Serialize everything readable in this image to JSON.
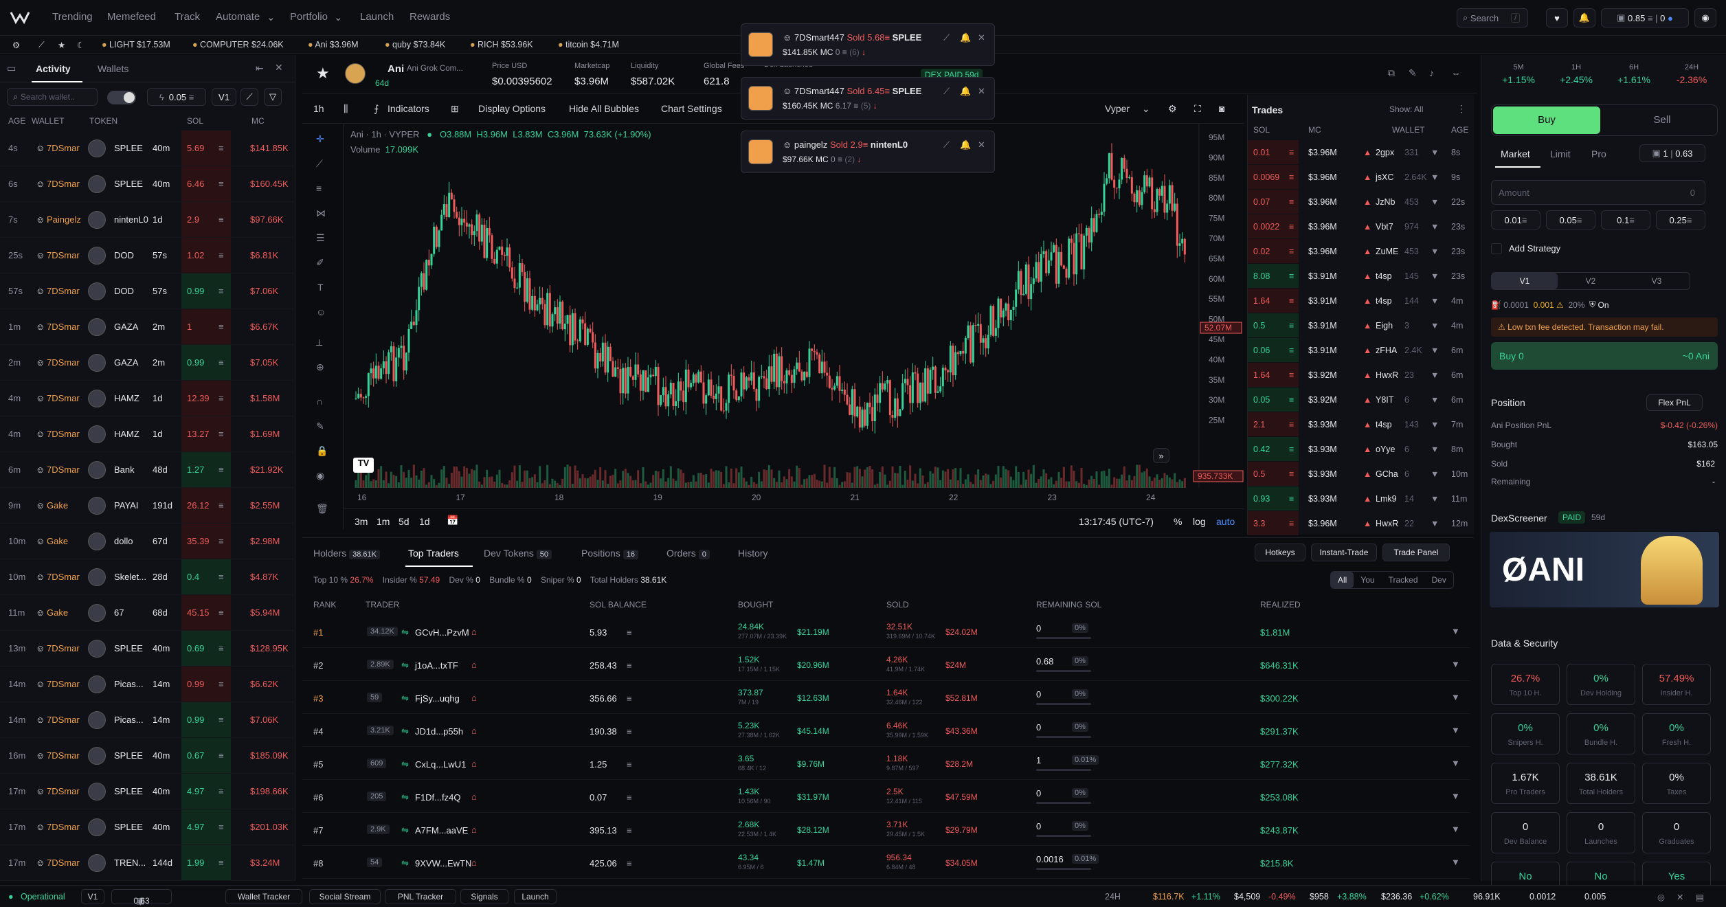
{
  "nav": {
    "items": [
      "Trending",
      "Memefeed",
      "Track",
      "Automate",
      "Portfolio",
      "Launch",
      "Rewards"
    ],
    "search_placeholder": "Search",
    "search_shortcut": "/",
    "wallet_balance": "0.85",
    "wallet_count": "0"
  },
  "ticker": [
    {
      "name": "LIGHT",
      "mc": "$17.53M"
    },
    {
      "name": "COMPUTER",
      "mc": "$24.06K"
    },
    {
      "name": "Ani",
      "mc": "$3.96M"
    },
    {
      "name": "quby",
      "mc": "$73.84K"
    },
    {
      "name": "RICH",
      "mc": "$53.96K"
    },
    {
      "name": "titcoin",
      "mc": "$4.71M"
    }
  ],
  "activity": {
    "tabs": [
      "Activity",
      "Wallets"
    ],
    "search_placeholder": "Search wallet..",
    "amount": "0.05",
    "version": "V1",
    "headers": [
      "AGE",
      "WALLET",
      "TOKEN",
      "SOL",
      "MC"
    ],
    "rows": [
      [
        "4s",
        "7DSmar",
        "SPLEE",
        "40m",
        "5.69",
        "$141.85K",
        "r"
      ],
      [
        "6s",
        "7DSmar",
        "SPLEE",
        "40m",
        "6.46",
        "$160.45K",
        "r"
      ],
      [
        "7s",
        "Paingelz",
        "nintenL0",
        "1d",
        "2.9",
        "$97.66K",
        "r"
      ],
      [
        "25s",
        "7DSmar",
        "DOD",
        "57s",
        "1.02",
        "$6.81K",
        "r"
      ],
      [
        "57s",
        "7DSmar",
        "DOD",
        "57s",
        "0.99",
        "$7.06K",
        "g"
      ],
      [
        "1m",
        "7DSmar",
        "GAZA",
        "2m",
        "1",
        "$6.67K",
        "r"
      ],
      [
        "2m",
        "7DSmar",
        "GAZA",
        "2m",
        "0.99",
        "$7.05K",
        "g"
      ],
      [
        "4m",
        "7DSmar",
        "HAMZ",
        "1d",
        "12.39",
        "$1.58M",
        "r"
      ],
      [
        "4m",
        "7DSmar",
        "HAMZ",
        "1d",
        "13.27",
        "$1.69M",
        "r"
      ],
      [
        "6m",
        "7DSmar",
        "Bank",
        "48d",
        "1.27",
        "$21.92K",
        "g"
      ],
      [
        "9m",
        "Gake",
        "PAYAI",
        "191d",
        "26.12",
        "$2.55M",
        "r"
      ],
      [
        "10m",
        "Gake",
        "dollo",
        "67d",
        "35.39",
        "$2.98M",
        "r"
      ],
      [
        "10m",
        "7DSmar",
        "Skelet...",
        "28d",
        "0.4",
        "$4.87K",
        "g"
      ],
      [
        "11m",
        "Gake",
        "67",
        "68d",
        "45.15",
        "$5.94M",
        "r"
      ],
      [
        "13m",
        "7DSmar",
        "SPLEE",
        "40m",
        "0.69",
        "$128.95K",
        "g"
      ],
      [
        "14m",
        "7DSmar",
        "Picas...",
        "14m",
        "0.99",
        "$6.62K",
        "r"
      ],
      [
        "14m",
        "7DSmar",
        "Picas...",
        "14m",
        "0.99",
        "$7.06K",
        "g"
      ],
      [
        "16m",
        "7DSmar",
        "SPLEE",
        "40m",
        "0.67",
        "$185.09K",
        "g"
      ],
      [
        "17m",
        "7DSmar",
        "SPLEE",
        "40m",
        "4.97",
        "$198.66K",
        "g"
      ],
      [
        "17m",
        "7DSmar",
        "SPLEE",
        "40m",
        "4.97",
        "$201.03K",
        "g"
      ],
      [
        "17m",
        "7DSmar",
        "TREN...",
        "144d",
        "1.99",
        "$3.24M",
        "g"
      ]
    ]
  },
  "token": {
    "symbol": "Ani",
    "name": "Ani Grok Com...",
    "age": "64d",
    "price_label": "Price USD",
    "price": "$0.00395602",
    "mc_label": "Marketcap",
    "mc": "$3.96M",
    "liq_label": "Liquidity",
    "liq": "$587.02K",
    "fees_label": "Global Fees",
    "fees": "621.8",
    "dex_label": "Dex Launched",
    "dex_paid": "DEX PAID 59d"
  },
  "chart_tools": {
    "interval": "1h",
    "indicators": "Indicators",
    "display": "Display Options",
    "hide": "Hide All Bubbles",
    "settings": "Chart Settings",
    "source": "Vyper"
  },
  "chart_legend": {
    "title": "Ani · 1h · VYPER",
    "o": "O3.88M",
    "h": "H3.96M",
    "l": "L3.83M",
    "c": "C3.96M",
    "chg": "73.63K (+1.90%)",
    "volume": "Volume",
    "vol_val": "17.099K",
    "last": "52.07M",
    "vol_last": "935.733K"
  },
  "chart_data": {
    "type": "candlestick",
    "y_ticks": [
      "95M",
      "90M",
      "85M",
      "80M",
      "75M",
      "70M",
      "65M",
      "60M",
      "55M",
      "50M",
      "45M",
      "40M",
      "35M",
      "30M",
      "25M"
    ],
    "x_ticks": [
      "16",
      "17",
      "18",
      "19",
      "20",
      "21",
      "22",
      "23",
      "24"
    ]
  },
  "chart_foot": {
    "ranges": [
      "3m",
      "1m",
      "5d",
      "1d"
    ],
    "time": "13:17:45 (UTC-7)",
    "pct": "%",
    "log": "log",
    "auto": "auto"
  },
  "toasts": [
    {
      "user": "7DSmart447",
      "action": "Sold",
      "amt": "5.68",
      "token": "SPLEE",
      "mc": "$141.85K MC",
      "extra": "0",
      "count": "(6)"
    },
    {
      "user": "7DSmart447",
      "action": "Sold",
      "amt": "6.45",
      "token": "SPLEE",
      "mc": "$160.45K MC",
      "extra": "6.17",
      "count": "(5)"
    },
    {
      "user": "paingelz",
      "action": "Sold",
      "amt": "2.9",
      "token": "nintenL0",
      "mc": "$97.66K MC",
      "extra": "0",
      "count": "(2)"
    }
  ],
  "trades": {
    "title": "Trades",
    "show": "Show: All",
    "headers": [
      "SOL",
      "MC",
      "WALLET",
      "AGE"
    ],
    "rows": [
      [
        "0.01",
        "$3.96M",
        "2gpx",
        "331",
        "8s",
        "r"
      ],
      [
        "0.0069",
        "$3.96M",
        "jsXC",
        "2.64K",
        "9s",
        "r"
      ],
      [
        "0.07",
        "$3.96M",
        "JzNb",
        "453",
        "22s",
        "r"
      ],
      [
        "0.0022",
        "$3.96M",
        "Vbt7",
        "974",
        "23s",
        "r"
      ],
      [
        "0.02",
        "$3.96M",
        "ZuME",
        "453",
        "23s",
        "r"
      ],
      [
        "8.08",
        "$3.91M",
        "t4sp",
        "145",
        "23s",
        "g"
      ],
      [
        "1.64",
        "$3.91M",
        "t4sp",
        "144",
        "4m",
        "r"
      ],
      [
        "0.5",
        "$3.91M",
        "Eigh",
        "3",
        "4m",
        "g"
      ],
      [
        "0.06",
        "$3.91M",
        "zFHA",
        "2.4K",
        "6m",
        "g"
      ],
      [
        "1.64",
        "$3.92M",
        "HwxR",
        "23",
        "6m",
        "r"
      ],
      [
        "0.05",
        "$3.92M",
        "Y8IT",
        "6",
        "6m",
        "g"
      ],
      [
        "2.1",
        "$3.93M",
        "t4sp",
        "143",
        "7m",
        "r"
      ],
      [
        "0.42",
        "$3.93M",
        "oYye",
        "6",
        "8m",
        "g"
      ],
      [
        "0.5",
        "$3.93M",
        "GCha",
        "6",
        "10m",
        "r"
      ],
      [
        "0.93",
        "$3.93M",
        "Lmk9",
        "14",
        "11m",
        "g"
      ],
      [
        "3.3",
        "$3.96M",
        "HwxR",
        "22",
        "12m",
        "r"
      ]
    ]
  },
  "bottom": {
    "tabs": [
      {
        "l": "Holders",
        "c": "38.61K"
      },
      {
        "l": "Top Traders",
        "c": ""
      },
      {
        "l": "Dev Tokens",
        "c": "50"
      },
      {
        "l": "Positions",
        "c": "16"
      },
      {
        "l": "Orders",
        "c": "0"
      },
      {
        "l": "History",
        "c": ""
      }
    ],
    "actions": [
      "Hotkeys",
      "Instant-Trade",
      "Trade Panel"
    ],
    "filters": {
      "top10": "Top 10 %",
      "top10v": "26.7%",
      "insider": "Insider %",
      "insiderv": "57.49",
      "dev": "Dev %",
      "devv": "0",
      "bundle": "Bundle %",
      "bundlev": "0",
      "sniper": "Sniper %",
      "sniperv": "0",
      "holders": "Total Holders",
      "holdersv": "38.61K"
    },
    "scope": [
      "All",
      "You",
      "Tracked",
      "Dev"
    ],
    "headers": [
      "RANK",
      "TRADER",
      "SOL BALANCE",
      "BOUGHT",
      "SOLD",
      "REMAINING SOL",
      "REALIZED"
    ],
    "rows": [
      [
        "#1",
        "34.12K",
        "GCvH...PzvM",
        "5.93",
        "24.84K",
        "277.07M / 23.39K",
        "$21.19M",
        "32.51K",
        "319.69M / 10.74K",
        "$24.02M",
        "0",
        "0%",
        "$1.81M"
      ],
      [
        "#2",
        "2.89K",
        "j1oA...txTF",
        "258.43",
        "1.52K",
        "17.15M / 1.15K",
        "$20.96M",
        "4.26K",
        "41.9M / 1.74K",
        "$24M",
        "0.68",
        "0%",
        "$646.31K"
      ],
      [
        "#3",
        "59",
        "FjSy...uqhg",
        "356.66",
        "373.87",
        "7M / 19",
        "$12.63M",
        "1.64K",
        "32.46M / 122",
        "$52.81M",
        "0",
        "0%",
        "$300.22K"
      ],
      [
        "#4",
        "3.21K",
        "JD1d...p55h",
        "190.38",
        "5.23K",
        "27.38M / 1.62K",
        "$45.14M",
        "6.46K",
        "35.99M / 1.59K",
        "$43.36M",
        "0",
        "0%",
        "$291.37K"
      ],
      [
        "#5",
        "609",
        "CxLq...LwU1",
        "1.25",
        "3.65",
        "68.4K / 12",
        "$9.76M",
        "1.18K",
        "9.87M / 597",
        "$28.2M",
        "1",
        "0.01%",
        "$277.32K"
      ],
      [
        "#6",
        "205",
        "F1Df...fz4Q",
        "0.07",
        "1.43K",
        "10.56M / 90",
        "$31.97M",
        "2.5K",
        "12.41M / 115",
        "$47.59M",
        "0",
        "0%",
        "$253.08K"
      ],
      [
        "#7",
        "2.9K",
        "A7FM...aaVE",
        "395.13",
        "2.68K",
        "22.53M / 1.4K",
        "$28.12M",
        "3.71K",
        "29.45M / 1.5K",
        "$29.79M",
        "0",
        "0%",
        "$243.87K"
      ],
      [
        "#8",
        "54",
        "9XVW...EwTN",
        "425.06",
        "43.34",
        "6.95M / 6",
        "$1.47M",
        "956.34",
        "6.84M / 48",
        "$34.05M",
        "0.0016",
        "0.01%",
        "$215.8K"
      ]
    ]
  },
  "right": {
    "timeframes": [
      {
        "l": "5M",
        "v": "+1.15%",
        "c": "g"
      },
      {
        "l": "1H",
        "v": "+2.45%",
        "c": "g"
      },
      {
        "l": "6H",
        "v": "+1.61%",
        "c": "g"
      },
      {
        "l": "24H",
        "v": "-2.36%",
        "c": "r"
      }
    ],
    "buy": "Buy",
    "sell": "Sell",
    "modes": [
      "Market",
      "Limit",
      "Pro"
    ],
    "preset": "1",
    "preset_amt": "0.63",
    "amount_placeholder": "Amount",
    "amount_val": "0",
    "quick": [
      "0.01",
      "0.05",
      "0.1",
      "0.25"
    ],
    "strategy": "Add Strategy",
    "versions": [
      "V1",
      "V2",
      "V3"
    ],
    "fee": "0.0001",
    "prio": "0.001",
    "slip": "20%",
    "mev": "On",
    "warning": "Low txn fee detected. Transaction may fail.",
    "buy_btn": "Buy 0",
    "buy_recv": "~0 Ani",
    "position": "Position",
    "flex": "Flex PnL",
    "pnl_label": "Ani Position PnL",
    "pnl": "$-0.42 (-0.26%)",
    "bought_label": "Bought",
    "bought": "$163.05",
    "sold_label": "Sold",
    "sold": "$162",
    "rem_label": "Remaining",
    "rem": "-",
    "dex": "DexScreener",
    "paid": "PAID",
    "paid_age": "59d",
    "banner": "ØANI",
    "security": "Data & Security",
    "stats": [
      {
        "v": "26.7%",
        "l": "Top 10 H.",
        "c": "r"
      },
      {
        "v": "0%",
        "l": "Dev Holding",
        "c": "g"
      },
      {
        "v": "57.49%",
        "l": "Insider H.",
        "c": "r"
      },
      {
        "v": "0%",
        "l": "Snipers H.",
        "c": "g"
      },
      {
        "v": "0%",
        "l": "Bundle H.",
        "c": "g"
      },
      {
        "v": "0%",
        "l": "Fresh H.",
        "c": "g"
      },
      {
        "v": "1.67K",
        "l": "Pro Traders",
        "c": ""
      },
      {
        "v": "38.61K",
        "l": "Total Holders",
        "c": ""
      },
      {
        "v": "0%",
        "l": "Taxes",
        "c": ""
      },
      {
        "v": "0",
        "l": "Dev Balance",
        "c": ""
      },
      {
        "v": "0",
        "l": "Launches",
        "c": ""
      },
      {
        "v": "0",
        "l": "Graduates",
        "c": ""
      },
      {
        "v": "No",
        "l": "",
        "c": "g"
      },
      {
        "v": "No",
        "l": "",
        "c": "g"
      },
      {
        "v": "Yes",
        "l": "",
        "c": "g"
      }
    ]
  },
  "status": {
    "state": "Operational",
    "ver": "V1",
    "preset": "1",
    "amt": "0.63",
    "links": [
      "Wallet Tracker",
      "Social Stream",
      "PNL Tracker",
      "Signals",
      "Launch"
    ],
    "period": "24H",
    "btc": "$116.7K",
    "btc_chg": "+1.11%",
    "eth": "$4,509",
    "eth_chg": "-0.49%",
    "sol": "$958",
    "sol_chg": "+3.88%",
    "sol2": "$236.36",
    "sol2_chg": "+0.62%",
    "a": "96.91K",
    "b": "0.0012",
    "c": "0.005"
  },
  "colors": {
    "green": "#36d399",
    "red": "#f05b5b",
    "accent": "#5ee07f",
    "bg": "#0b0c10"
  }
}
